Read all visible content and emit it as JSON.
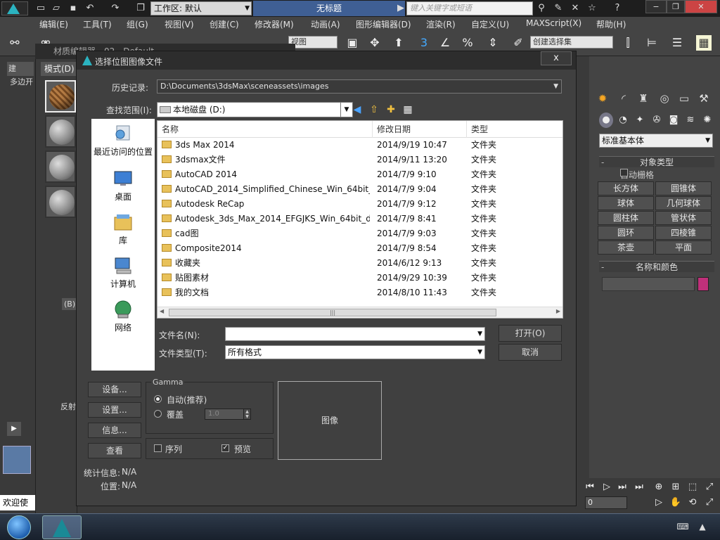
{
  "app": {
    "workspace_label": "工作区: 默认",
    "document_title": "无标题",
    "search_placeholder": "键入关键字或短语"
  },
  "menu": [
    "编辑(E)",
    "工具(T)",
    "组(G)",
    "视图(V)",
    "创建(C)",
    "修改器(M)",
    "动画(A)",
    "图形编辑器(D)",
    "渲染(R)",
    "自定义(U)",
    "MAXScript(X)",
    "帮助(H)"
  ],
  "toolbar": {
    "view_dropdown": "视图",
    "selection_set_placeholder": "创建选择集",
    "spinner_label": "3",
    "percent_label": "%"
  },
  "left_panel": {
    "tab": "建",
    "label": "多边开",
    "welcome": "欢迎使用"
  },
  "material_editor": {
    "title": "材质编辑器 - 02 - Default",
    "mode_menu": "模式(D)",
    "slot_label": "(B)",
    "reflect_label": "反射"
  },
  "command_panel": {
    "category": "标准基本体",
    "object_type_header": "对象类型",
    "autogrid_label": "自动栅格",
    "object_buttons": [
      "长方体",
      "圆锥体",
      "球体",
      "几何球体",
      "圆柱体",
      "管状体",
      "圆环",
      "四棱锥",
      "茶壶",
      "平面"
    ],
    "name_color_header": "名称和颜色",
    "frame_value": "0",
    "swatch_color": "#c0307a"
  },
  "dialog": {
    "title": "选择位图图像文件",
    "close_label": "x",
    "history_label": "历史记录:",
    "history_value": "D:\\Documents\\3dsMax\\sceneassets\\images",
    "lookin_label": "查找范围(I):",
    "lookin_value": "本地磁盘 (D:)",
    "places": [
      "最近访问的位置",
      "桌面",
      "库",
      "计算机",
      "网络"
    ],
    "columns": [
      "名称",
      "修改日期",
      "类型"
    ],
    "files": [
      {
        "name": "3ds Max 2014",
        "date": "2014/9/19 10:47",
        "type": "文件夹"
      },
      {
        "name": "3dsmax文件",
        "date": "2014/9/11 13:20",
        "type": "文件夹"
      },
      {
        "name": "AutoCAD 2014",
        "date": "2014/7/9 9:10",
        "type": "文件夹"
      },
      {
        "name": "AutoCAD_2014_Simplified_Chinese_Win_64bit_...",
        "date": "2014/7/9 9:04",
        "type": "文件夹"
      },
      {
        "name": "Autodesk ReCap",
        "date": "2014/7/9 9:12",
        "type": "文件夹"
      },
      {
        "name": "Autodesk_3ds_Max_2014_EFGJKS_Win_64bit_d...",
        "date": "2014/7/9 8:41",
        "type": "文件夹"
      },
      {
        "name": "cad图",
        "date": "2014/7/9 9:03",
        "type": "文件夹"
      },
      {
        "name": "Composite2014",
        "date": "2014/7/9 8:54",
        "type": "文件夹"
      },
      {
        "name": "收藏夹",
        "date": "2014/6/12 9:13",
        "type": "文件夹"
      },
      {
        "name": "贴图素材",
        "date": "2014/9/29 10:39",
        "type": "文件夹"
      },
      {
        "name": "我的文档",
        "date": "2014/8/10 11:43",
        "type": "文件夹"
      }
    ],
    "filename_label": "文件名(N):",
    "filename_value": "",
    "filetype_label": "文件类型(T):",
    "filetype_value": "所有格式",
    "open_button": "打开(O)",
    "cancel_button": "取消",
    "setup_button": "设备...",
    "settings_button": "设置...",
    "info_button": "信息...",
    "view_button": "查看",
    "gamma_title": "Gamma",
    "gamma_auto": "自动(推荐)",
    "gamma_override": "覆盖",
    "gamma_override_value": "1.0",
    "sequence_label": "序列",
    "preview_label": "预览",
    "image_label": "图像",
    "stats_label": "统计信息:",
    "stats_value": "N/A",
    "location_label": "位置:",
    "location_value": "N/A"
  }
}
